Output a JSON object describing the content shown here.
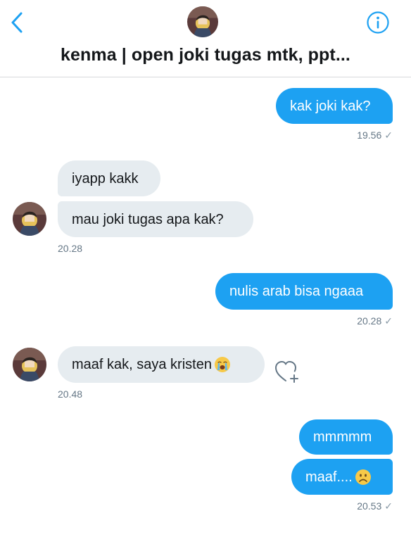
{
  "header": {
    "title": "kenma | open joki tugas mtk, ppt...",
    "back_icon": "chevron-left-icon",
    "info_icon": "info-icon"
  },
  "colors": {
    "accent": "#1da1f2",
    "incoming_bubble": "#e6ecf0",
    "timestamp": "#657786"
  },
  "messages": [
    {
      "direction": "out",
      "text": "kak joki kak?"
    },
    {
      "direction": "out_time",
      "time": "19.56",
      "receipt": "✓"
    },
    {
      "direction": "in",
      "text": "iyapp kakk"
    },
    {
      "direction": "in",
      "text": "mau joki tugas apa kak?"
    },
    {
      "direction": "in_time",
      "time": "20.28"
    },
    {
      "direction": "out",
      "text": "nulis arab bisa ngaaa"
    },
    {
      "direction": "out_time",
      "time": "20.28",
      "receipt": "✓"
    },
    {
      "direction": "in",
      "text": "maaf kak, saya kristen",
      "emoji": "loudly-crying-face-icon"
    },
    {
      "direction": "in_time",
      "time": "20.48"
    },
    {
      "direction": "out",
      "text": "mmmmm"
    },
    {
      "direction": "out",
      "text": "maaf....",
      "emoji": "frowning-face-icon"
    },
    {
      "direction": "out_time",
      "time": "20.53",
      "receipt": "✓"
    }
  ],
  "reaction_icon": "heart-plus-icon"
}
